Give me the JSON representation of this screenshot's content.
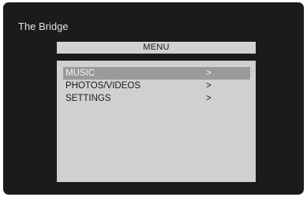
{
  "header": {
    "device_name": "The Bridge"
  },
  "menu": {
    "title": "MENU",
    "selected_index": 0,
    "items": [
      {
        "label": "MUSIC",
        "arrow": ">"
      },
      {
        "label": "PHOTOS/VIDEOS",
        "arrow": ">"
      },
      {
        "label": "SETTINGS",
        "arrow": ">"
      }
    ]
  },
  "colors": {
    "background": "#1b1b1b",
    "panel": "#d0d0d0",
    "highlight": "#9a9a9a",
    "text_dark": "#1a1a1a",
    "text_light": "#e2e2e2"
  }
}
